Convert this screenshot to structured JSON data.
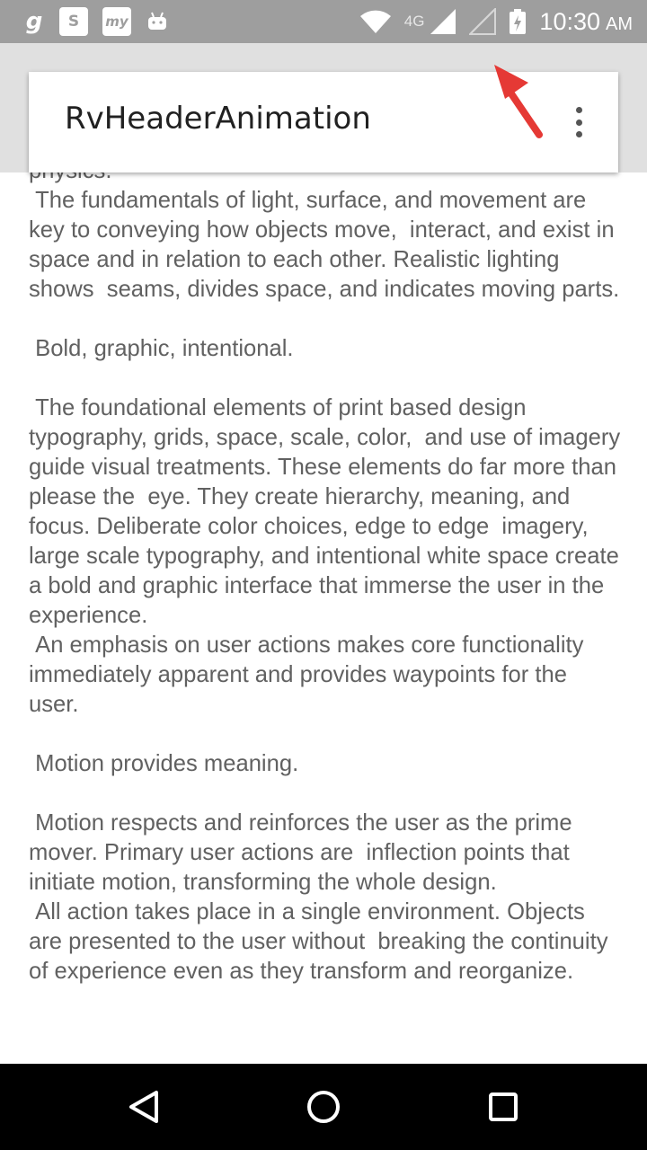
{
  "status_bar": {
    "app_icons": [
      "g",
      "S",
      "my"
    ],
    "network": "4G",
    "time": "10:30",
    "ampm": "AM"
  },
  "toolbar": {
    "title": "RvHeaderAnimation"
  },
  "content": {
    "text": "physics.\n The fundamentals of light, surface, and movement are key to conveying how objects move,  interact, and exist in space and in relation to each other. Realistic lighting shows  seams, divides space, and indicates moving parts.\n\n Bold, graphic, intentional.\n\n The foundational elements of print based design typography, grids, space, scale, color,  and use of imagery guide visual treatments. These elements do far more than please the  eye. They create hierarchy, meaning, and focus. Deliberate color choices, edge to edge  imagery, large scale typography, and intentional white space create a bold and graphic interface that immerse the user in the experience.\n An emphasis on user actions makes core functionality immediately apparent and provides waypoints for the user.\n\n Motion provides meaning.\n\n Motion respects and reinforces the user as the prime mover. Primary user actions are  inflection points that initiate motion, transforming the whole design.\n All action takes place in a single environment. Objects are presented to the user without  breaking the continuity of experience even as they transform and reorganize."
  },
  "colors": {
    "status_bar": "#9e9e9e",
    "header_bg": "#e0e0e0",
    "text": "#616161",
    "title": "#212121",
    "arrow": "#e53935"
  },
  "icons": {
    "overflow": "more-vert-icon",
    "arrow": "red-arrow-icon",
    "nav": [
      "back-icon",
      "home-icon",
      "recent-apps-icon"
    ]
  }
}
